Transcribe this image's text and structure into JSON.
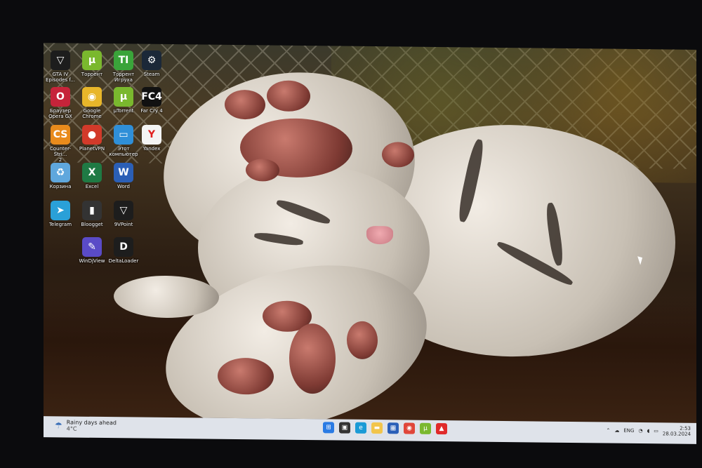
{
  "desktop_icons": [
    {
      "label": "GTA IV\nEpisodes f...",
      "icon": "gta-icon",
      "color": "#1d1d1d",
      "glyph": "▽"
    },
    {
      "label": "Торрент",
      "icon": "utorrent-icon",
      "color": "#7ab82e",
      "glyph": "µ"
    },
    {
      "label": "Торрент\nИгруха",
      "icon": "torrent-igruha-icon",
      "color": "#3aa43a",
      "glyph": "TI"
    },
    {
      "label": "Steam",
      "icon": "steam-icon",
      "color": "#1b2838",
      "glyph": "⚙"
    },
    {
      "label": "Браузер\nOpera GX",
      "icon": "opera-gx-icon",
      "color": "#c6243a",
      "glyph": "O"
    },
    {
      "label": "Google\nChrome",
      "icon": "chrome-icon",
      "color": "#e8b62a",
      "glyph": "◉"
    },
    {
      "label": "µTorrent",
      "icon": "utorrent-icon",
      "color": "#7ab82e",
      "glyph": "µ"
    },
    {
      "label": "Far Cry 4",
      "icon": "farcry4-icon",
      "color": "#111111",
      "glyph": "FC4"
    },
    {
      "label": "Counter-Stri...\n2",
      "icon": "counter-strike-icon",
      "color": "#e98b1c",
      "glyph": "CS"
    },
    {
      "label": "PlanetVPN",
      "icon": "planetvpn-icon",
      "color": "#d23a2a",
      "glyph": "●"
    },
    {
      "label": "Этот\nкомпьютер",
      "icon": "computer-icon",
      "color": "#2f8fd8",
      "glyph": "▭"
    },
    {
      "label": "Yandex",
      "icon": "yandex-icon",
      "color": "#f4f4f4",
      "glyph": "Y"
    },
    {
      "label": "Корзина",
      "icon": "recycle-bin-icon",
      "color": "#5fa7dd",
      "glyph": "♻"
    },
    {
      "label": "Excel",
      "icon": "excel-icon",
      "color": "#1f7a44",
      "glyph": "X"
    },
    {
      "label": "Word",
      "icon": "word-icon",
      "color": "#2b5fb6",
      "glyph": "W"
    },
    {
      "label": "Telegram",
      "icon": "telegram-icon",
      "color": "#2aa0d8",
      "glyph": "➤"
    },
    {
      "label": "Bloogget",
      "icon": "bloogget-icon",
      "color": "#333333",
      "glyph": "▮"
    },
    {
      "label": "9VPoint",
      "icon": "vpoint-icon",
      "color": "#1d1d1d",
      "glyph": "▽"
    },
    {
      "label": "WinDjView",
      "icon": "windjview-icon",
      "color": "#5a4bc7",
      "glyph": "✎"
    },
    {
      "label": "DeltaLoader",
      "icon": "deltaloader-icon",
      "color": "#1d1d1d",
      "glyph": "D"
    }
  ],
  "taskbar": {
    "weather_title": "Rainy days ahead",
    "weather_temp": "4°C",
    "apps": [
      {
        "icon": "windows-start-icon",
        "color": "#2a7be4",
        "glyph": "⊞"
      },
      {
        "icon": "task-view-icon",
        "color": "#333333",
        "glyph": "▣"
      },
      {
        "icon": "edge-icon",
        "color": "#1b9bd6",
        "glyph": "e"
      },
      {
        "icon": "file-explorer-icon",
        "color": "#f2c54c",
        "glyph": "▬"
      },
      {
        "icon": "store-icon",
        "color": "#2a5fb8",
        "glyph": "▦"
      },
      {
        "icon": "chrome-icon",
        "color": "#e0463a",
        "glyph": "◉"
      },
      {
        "icon": "utorrent-icon",
        "color": "#7ab82e",
        "glyph": "µ"
      },
      {
        "icon": "app-red-icon",
        "color": "#e02a2a",
        "glyph": "▲"
      }
    ],
    "language": "ENG",
    "time": "2:53",
    "date": "28.03.2024"
  }
}
